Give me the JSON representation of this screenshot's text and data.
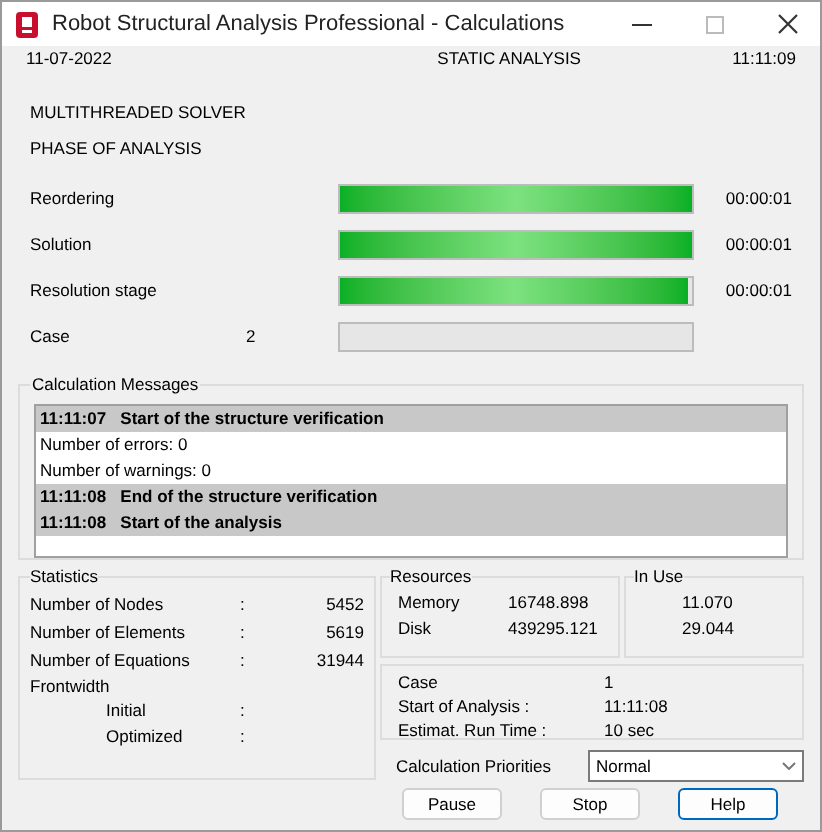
{
  "window": {
    "title": "Robot Structural Analysis Professional - Calculations"
  },
  "header": {
    "date": "11-07-2022",
    "analysis": "STATIC ANALYSIS",
    "time": "11:11:09"
  },
  "solver": "MULTITHREADED SOLVER",
  "phase_title": "PHASE OF ANALYSIS",
  "phases": [
    {
      "label": "Reordering",
      "level": 1,
      "time": "00:00:01"
    },
    {
      "label": "Solution",
      "level": 1,
      "time": "00:00:01"
    },
    {
      "label": "Resolution stage",
      "level": 0.99,
      "time": "00:00:01"
    },
    {
      "label": "Case",
      "value": "2",
      "level": 0
    }
  ],
  "messages": {
    "title": "Calculation Messages",
    "items": [
      {
        "kind": "event",
        "time": "11:11:07",
        "text": "Start of the structure verification"
      },
      {
        "kind": "info",
        "text": "Number of errors: 0"
      },
      {
        "kind": "info",
        "text": "Number of warnings: 0"
      },
      {
        "kind": "event",
        "time": "11:11:08",
        "text": "End of the structure verification"
      },
      {
        "kind": "event",
        "time": "11:11:08",
        "text": "Start of the analysis"
      }
    ]
  },
  "statistics": {
    "title": "Statistics",
    "rows": [
      {
        "label": "Number of Nodes",
        "separator": ":",
        "value": "5452"
      },
      {
        "label": "Number of Elements",
        "separator": ":",
        "value": "5619"
      },
      {
        "label": "Number of Equations",
        "separator": ":",
        "value": "31944"
      }
    ],
    "frontwidth": {
      "label": "Frontwidth",
      "children": [
        {
          "label": "Initial",
          "separator": ":"
        },
        {
          "label": "Optimized",
          "separator": ":"
        }
      ]
    }
  },
  "resources": {
    "title": "Resources",
    "rows": [
      {
        "label": "Memory",
        "value": "16748.898"
      },
      {
        "label": "Disk",
        "value": "439295.121"
      }
    ]
  },
  "in_use": {
    "title": "In Use",
    "values": [
      "11.070",
      "29.044"
    ]
  },
  "case_info": {
    "rows": [
      {
        "label": "Case",
        "value": "1"
      },
      {
        "label": "Start of Analysis :",
        "value": "11:11:08"
      },
      {
        "label": "Estimat. Run Time :",
        "value": "10 sec"
      }
    ]
  },
  "priorities": {
    "label": "Calculation Priorities",
    "value": "Normal"
  },
  "buttons": [
    {
      "label": "Pause",
      "default": false
    },
    {
      "label": "Stop",
      "default": false
    },
    {
      "label": "Help",
      "default": true
    }
  ]
}
